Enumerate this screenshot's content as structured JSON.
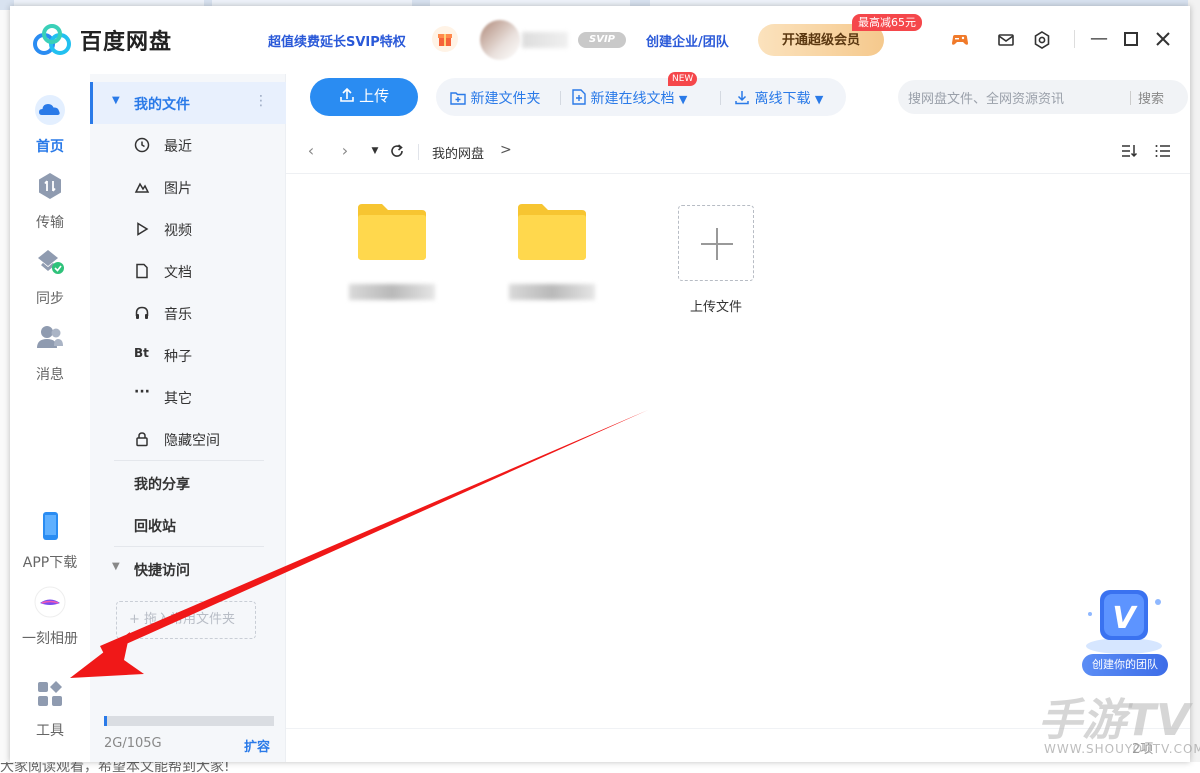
{
  "app": {
    "title": "百度网盘",
    "promo": "超值续费延长SVIP特权",
    "svip_badge": "SVIP",
    "enterprise": "创建企业/团队",
    "vip_button": "开通超级会员",
    "vip_tag": "最高减65元"
  },
  "leftnav": {
    "items": [
      {
        "label": "首页",
        "icon": "cloud-home-icon"
      },
      {
        "label": "传输",
        "icon": "transfer-icon"
      },
      {
        "label": "同步",
        "icon": "sync-icon"
      },
      {
        "label": "消息",
        "icon": "message-icon"
      }
    ],
    "bottom": [
      {
        "label": "APP下载",
        "icon": "phone-icon"
      },
      {
        "label": "一刻相册",
        "icon": "album-icon"
      },
      {
        "label": "工具",
        "icon": "tools-grid-icon"
      }
    ]
  },
  "folders": {
    "my_files": "我的文件",
    "items": [
      {
        "label": "最近",
        "icon": "clock-icon"
      },
      {
        "label": "图片",
        "icon": "image-icon"
      },
      {
        "label": "视频",
        "icon": "video-play-icon"
      },
      {
        "label": "文档",
        "icon": "document-icon"
      },
      {
        "label": "音乐",
        "icon": "headphones-icon"
      },
      {
        "label": "种子",
        "icon": "bt-icon",
        "glyph": "Bt"
      },
      {
        "label": "其它",
        "icon": "more-dots-icon"
      },
      {
        "label": "隐藏空间",
        "icon": "lock-icon"
      }
    ],
    "my_share": "我的分享",
    "recycle": "回收站",
    "quick_access": "快捷访问",
    "drop_hint": "+ 拖入常用文件夹",
    "quota": "2G/105G",
    "quota_fraction": 0.019,
    "expand": "扩容"
  },
  "toolbar": {
    "upload": "上传",
    "new_folder": "新建文件夹",
    "new_online_doc": "新建在线文档",
    "new_badge": "NEW",
    "offline_download": "离线下载",
    "search_placeholder": "搜网盘文件、全网资源资讯",
    "search_button": "搜索"
  },
  "breadcrumb": {
    "root": "我的网盘",
    "separator": ">"
  },
  "files": {
    "upload_tile_label": "上传文件",
    "count": "2项"
  },
  "team_widget": {
    "label": "创建你的团队",
    "glyph": "V"
  },
  "watermark": {
    "main": "手游TV",
    "sub": "WWW.SHOUYOUTV.COM"
  },
  "background": {
    "bottom_text": "大家阅读观看，希望本文能帮到大家!"
  },
  "colors": {
    "accent": "#2a7ae8",
    "annotation_arrow": "#f01818",
    "folder": "#ffd54a"
  }
}
